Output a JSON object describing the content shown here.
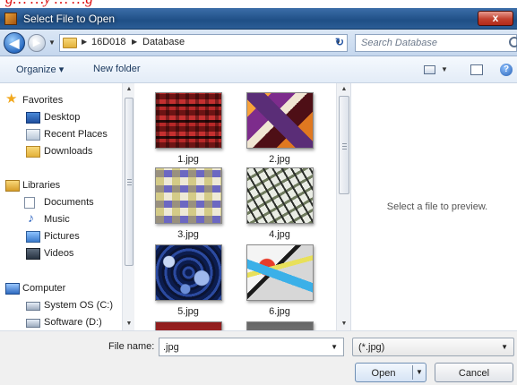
{
  "top_strip": {
    "partial_text": "g… …y … …g"
  },
  "window": {
    "title": "Select File to Open",
    "close_label": "x"
  },
  "navigation": {
    "back_glyph": "◀",
    "forward_glyph": "▶",
    "breadcrumb": [
      "16D018",
      "Database"
    ],
    "search_placeholder": "Search Database"
  },
  "toolbar": {
    "organize_label": "Organize ▾",
    "new_folder_label": "New folder",
    "help_glyph": "?"
  },
  "sidebar": {
    "favorites": {
      "label": "Favorites",
      "items": [
        "Desktop",
        "Recent Places",
        "Downloads"
      ]
    },
    "libraries": {
      "label": "Libraries",
      "items": [
        "Documents",
        "Music",
        "Pictures",
        "Videos"
      ]
    },
    "computer": {
      "label": "Computer",
      "items": [
        "System OS (C:)",
        "Software (D:)"
      ]
    }
  },
  "files": [
    "1.jpg",
    "2.jpg",
    "3.jpg",
    "4.jpg",
    "5.jpg",
    "6.jpg"
  ],
  "preview": {
    "text": "Select a file to preview."
  },
  "footer": {
    "file_name_label": "File name:",
    "file_name_value": ".jpg",
    "file_type_value": "(*.jpg)",
    "open_label": "Open",
    "cancel_label": "Cancel"
  }
}
